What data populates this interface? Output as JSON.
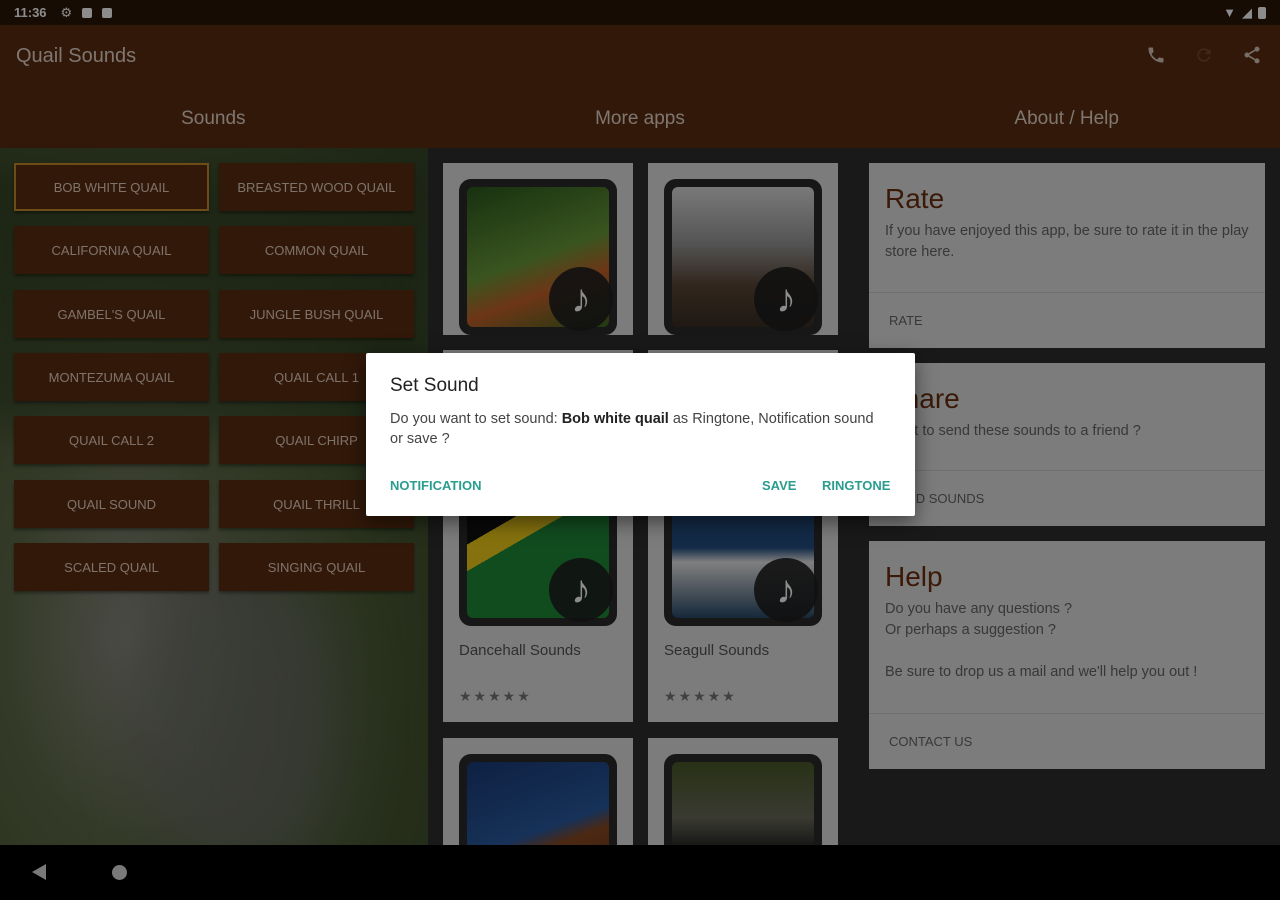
{
  "status": {
    "time": "11:36"
  },
  "app": {
    "title": "Quail Sounds"
  },
  "tabs": [
    {
      "label": "Sounds"
    },
    {
      "label": "More apps"
    },
    {
      "label": "About / Help"
    }
  ],
  "sounds": [
    "BOB WHITE QUAIL",
    "BREASTED WOOD QUAIL",
    "CALIFORNIA QUAIL",
    "COMMON QUAIL",
    "GAMBEL'S QUAIL",
    "JUNGLE BUSH QUAIL",
    "MONTEZUMA QUAIL",
    "QUAIL CALL 1",
    "QUAIL CALL 2",
    "QUAIL CHIRP",
    "QUAIL SOUND",
    "QUAIL THRILL",
    "SCALED QUAIL",
    "SINGING QUAIL"
  ],
  "apps": [
    {
      "name": "Dancehall Sounds",
      "rating": "★★★★★"
    },
    {
      "name": "Seagull Sounds",
      "rating": "★★★★★"
    }
  ],
  "about": {
    "rate": {
      "title": "Rate",
      "text": "If you have enjoyed this app, be sure to rate it in the play store here.",
      "action": "RATE"
    },
    "share": {
      "title": "Share",
      "text": "Want to send these sounds to a friend ?",
      "action": "SEND SOUNDS"
    },
    "help": {
      "title": "Help",
      "line1": "Do you have any questions ?",
      "line2": "Or perhaps a suggestion ?",
      "line3": "Be sure to drop us a mail and we'll help you out !",
      "action": "CONTACT US"
    }
  },
  "dialog": {
    "title": "Set Sound",
    "msg_before": "Do you want to set sound: ",
    "msg_sound": "Bob white quail",
    "msg_after": " as Ringtone, Notification sound or save ?",
    "notification": "NOTIFICATION",
    "save": "SAVE",
    "ringtone": "RINGTONE"
  },
  "colors": {
    "brand": "#5a2d12",
    "accent": "#2a9d8f",
    "selected_border": "#c98a2a"
  }
}
